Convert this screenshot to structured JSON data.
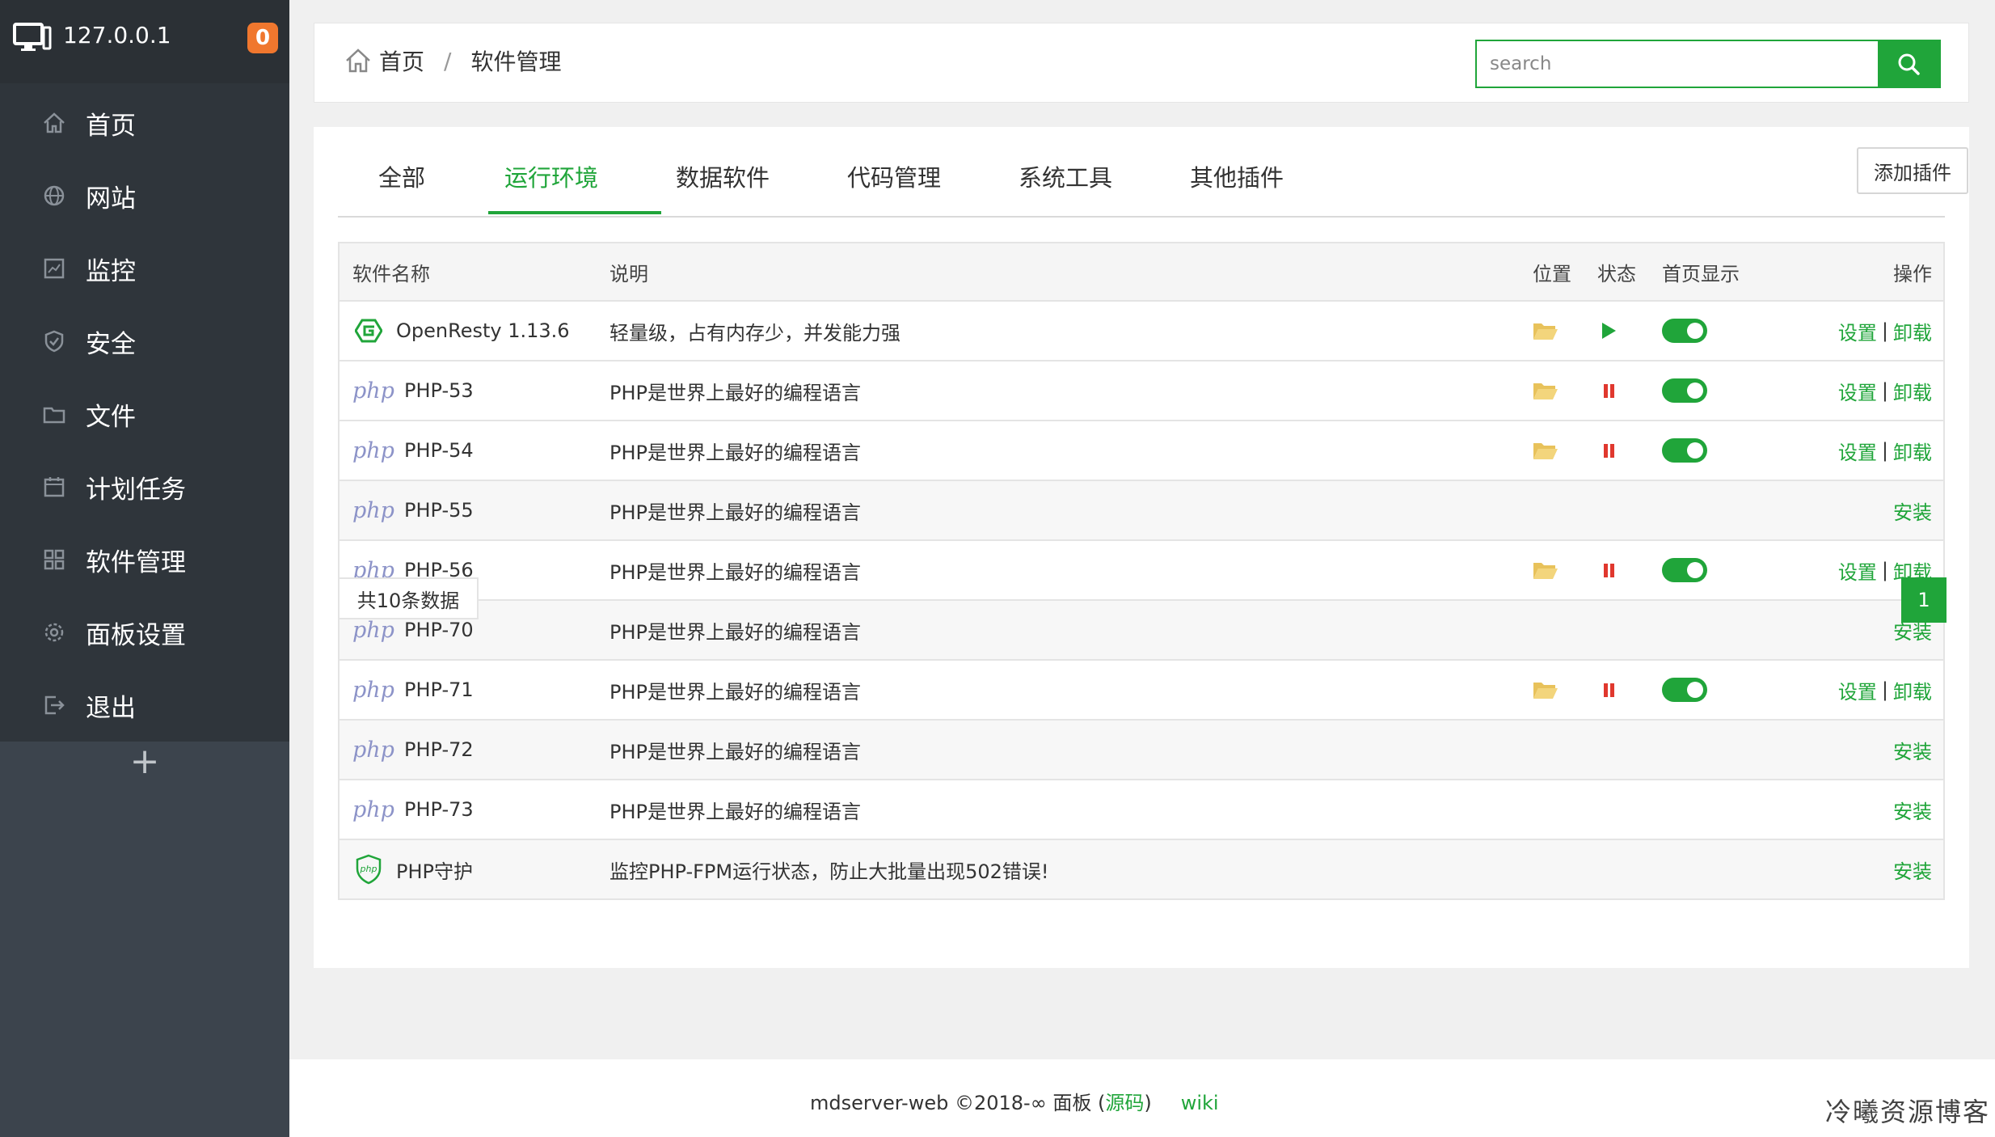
{
  "sidebar": {
    "host": "127.0.0.1",
    "badge": "0",
    "items": [
      {
        "label": "首页",
        "icon": "home-icon"
      },
      {
        "label": "网站",
        "icon": "globe-icon"
      },
      {
        "label": "监控",
        "icon": "monitor-chart-icon"
      },
      {
        "label": "安全",
        "icon": "shield-icon"
      },
      {
        "label": "文件",
        "icon": "folder-icon"
      },
      {
        "label": "计划任务",
        "icon": "calendar-icon"
      },
      {
        "label": "软件管理",
        "icon": "grid-icon"
      },
      {
        "label": "面板设置",
        "icon": "gear-icon"
      },
      {
        "label": "退出",
        "icon": "logout-icon"
      }
    ],
    "add_label": "+"
  },
  "header": {
    "breadcrumb": [
      "首页",
      "软件管理"
    ],
    "separator": "/",
    "search_placeholder": "search"
  },
  "tabs": {
    "items": [
      "全部",
      "运行环境",
      "数据软件",
      "代码管理",
      "系统工具",
      "其他插件"
    ],
    "active": "运行环境",
    "add_plugin": "添加插件"
  },
  "table": {
    "headers": {
      "name": "软件名称",
      "desc": "说明",
      "location": "位置",
      "status": "状态",
      "homepage": "首页显示",
      "action": "操作"
    },
    "rows": [
      {
        "icon": "openresty",
        "name": "OpenResty 1.13.6",
        "desc": "轻量级，占有内存少，并发能力强",
        "installed": true,
        "status": "play"
      },
      {
        "icon": "php",
        "name": "PHP-53",
        "desc": "PHP是世界上最好的编程语言",
        "installed": true,
        "status": "pause"
      },
      {
        "icon": "php",
        "name": "PHP-54",
        "desc": "PHP是世界上最好的编程语言",
        "installed": true,
        "status": "pause"
      },
      {
        "icon": "php",
        "name": "PHP-55",
        "desc": "PHP是世界上最好的编程语言",
        "installed": false
      },
      {
        "icon": "php",
        "name": "PHP-56",
        "desc": "PHP是世界上最好的编程语言",
        "installed": true,
        "status": "pause"
      },
      {
        "icon": "php",
        "name": "PHP-70",
        "desc": "PHP是世界上最好的编程语言",
        "installed": false
      },
      {
        "icon": "php",
        "name": "PHP-71",
        "desc": "PHP是世界上最好的编程语言",
        "installed": true,
        "status": "pause"
      },
      {
        "icon": "php",
        "name": "PHP-72",
        "desc": "PHP是世界上最好的编程语言",
        "installed": false
      },
      {
        "icon": "php",
        "name": "PHP-73",
        "desc": "PHP是世界上最好的编程语言",
        "installed": false
      },
      {
        "icon": "php-guard",
        "name": "PHP守护",
        "desc": "监控PHP-FPM运行状态，防止大批量出现502错误!",
        "installed": false
      }
    ],
    "php_label": "php",
    "guard_label": "php",
    "action_settings": "设置",
    "action_uninstall": "卸载",
    "action_install": "安装",
    "action_sep": "|"
  },
  "pagination": {
    "total": "共10条数据",
    "current": "1"
  },
  "footer": {
    "text_prefix": "mdserver-web ©2018-∞ 面板 (",
    "source_link": "源码",
    "text_suffix": ")",
    "wiki": "wiki"
  },
  "watermark": "冷曦资源博客",
  "colors": {
    "accent": "#20a53a",
    "sidebar": "#3c444d",
    "badge": "#f0772e",
    "pause": "#e0382e"
  }
}
